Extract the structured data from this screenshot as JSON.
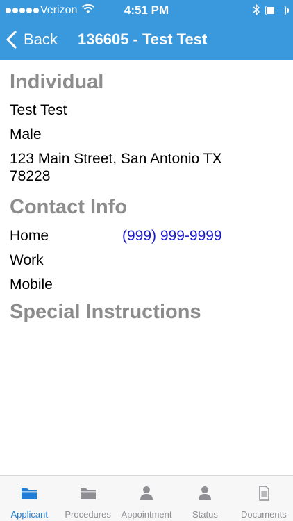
{
  "status_bar": {
    "carrier": "Verizon",
    "time": "4:51 PM",
    "battery_level": 0.45
  },
  "nav": {
    "back_label": "Back",
    "title": "136605 - Test Test"
  },
  "individual": {
    "heading": "Individual",
    "name": "Test Test",
    "gender": "Male",
    "address": "123 Main Street, San Antonio TX 78228"
  },
  "contact": {
    "heading": "Contact Info",
    "rows": [
      {
        "type": "Home",
        "value": "(999) 999-9999"
      },
      {
        "type": "Work",
        "value": ""
      },
      {
        "type": "Mobile",
        "value": ""
      }
    ]
  },
  "special": {
    "heading": "Special Instructions"
  },
  "tabs": [
    {
      "label": "Applicant",
      "icon": "folder-icon",
      "active": true
    },
    {
      "label": "Procedures",
      "icon": "folder-icon",
      "active": false
    },
    {
      "label": "Appointment",
      "icon": "person-icon",
      "active": false
    },
    {
      "label": "Status",
      "icon": "person-icon",
      "active": false
    },
    {
      "label": "Documents",
      "icon": "document-icon",
      "active": false
    }
  ],
  "colors": {
    "header_blue": "#3a99dc",
    "heading_gray": "#8c8c8c",
    "link_blue": "#1a1acc",
    "tab_active": "#1f7fd6",
    "tab_inactive": "#8e8e93"
  }
}
